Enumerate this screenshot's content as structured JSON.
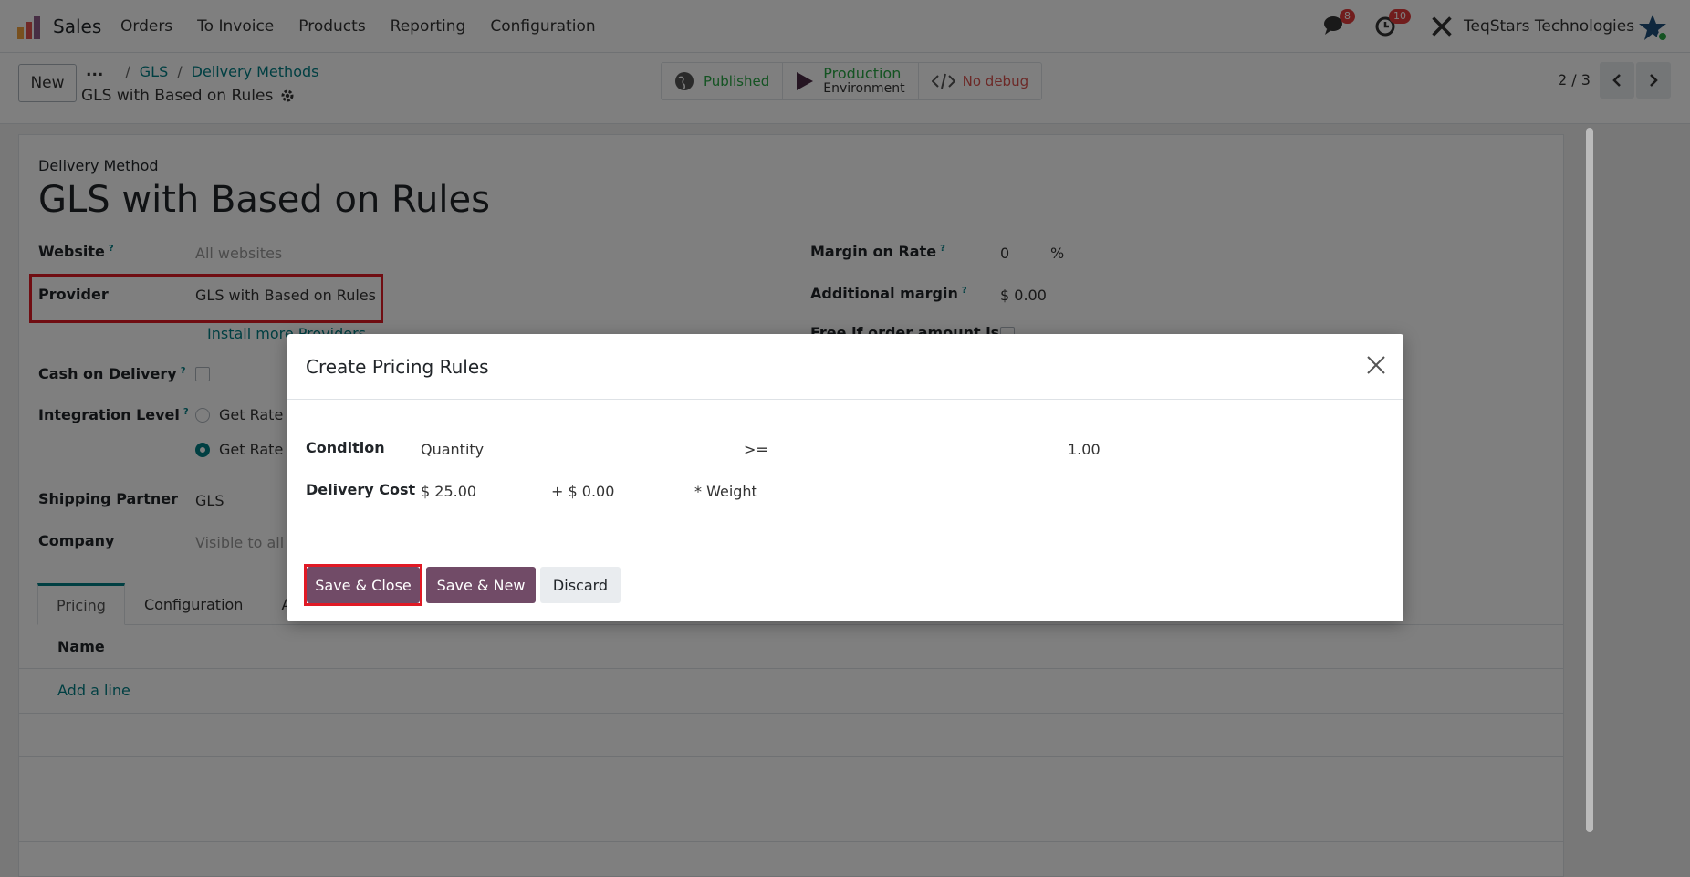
{
  "navbar": {
    "app_name": "Sales",
    "menu": [
      "Orders",
      "To Invoice",
      "Products",
      "Reporting",
      "Configuration"
    ],
    "messages_badge": "8",
    "activities_badge": "10",
    "company": "TeqStars Technologies"
  },
  "control": {
    "new_label": "New",
    "breadcrumb_dots": "...",
    "breadcrumb": [
      "GLS",
      "Delivery Methods"
    ],
    "record_title": "GLS with Based on Rules",
    "published_label": "Published",
    "production_label": "Production",
    "environment_label": "Environment",
    "debug_label": "No debug",
    "pager": "2 / 3"
  },
  "form": {
    "section_label": "Delivery Method",
    "title": "GLS with Based on Rules",
    "website_label": "Website",
    "website_value": "All websites",
    "provider_label": "Provider",
    "provider_value": "GLS with Based on Rules",
    "install_more": "Install more Providers",
    "cash_on_delivery_label": "Cash on Delivery",
    "integration_level_label": "Integration Level",
    "get_rate_1": "Get Rate",
    "get_rate_2": "Get Rate",
    "shipping_partner_label": "Shipping Partner",
    "shipping_partner_value": "GLS",
    "company_label": "Company",
    "company_value": "Visible to all",
    "margin_rate_label": "Margin on Rate",
    "margin_rate_value": "0",
    "margin_rate_unit": "%",
    "additional_margin_label": "Additional margin",
    "additional_margin_value": "$ 0.00",
    "free_if_label": "Free if order amount is",
    "help_mark": "?",
    "tabs": [
      "Pricing",
      "Configuration",
      "A"
    ],
    "list_header_name": "Name",
    "add_line": "Add a line"
  },
  "dialog": {
    "title": "Create Pricing Rules",
    "condition_label": "Condition",
    "condition_variable": "Quantity",
    "condition_operator": ">=",
    "condition_value": "1.00",
    "delivery_cost_label": "Delivery Cost",
    "base_price": "$ 25.00",
    "list_price": "+ $ 0.00",
    "variable_factor": "* Weight",
    "save_close": "Save & Close",
    "save_new": "Save & New",
    "discard": "Discard"
  },
  "colors": {
    "primary": "#714b67",
    "link": "#017e84",
    "highlight": "#e01a25"
  }
}
